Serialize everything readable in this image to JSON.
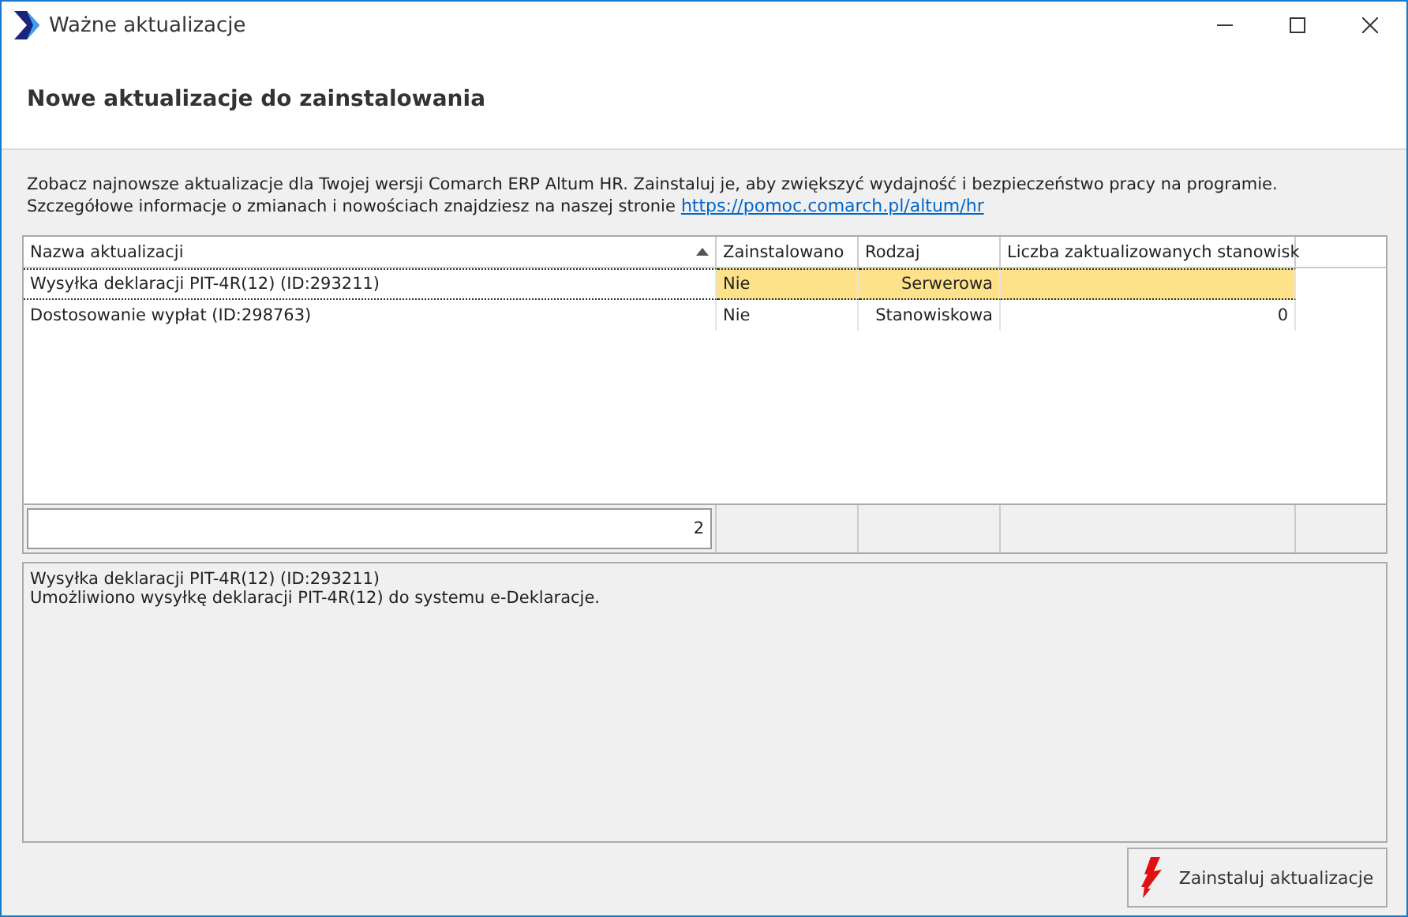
{
  "window": {
    "title": "Ważne aktualizacje"
  },
  "header": {
    "title": "Nowe aktualizacje do zainstalowania"
  },
  "intro": {
    "line_1": "Zobacz najnowsze aktualizacje dla Twojej wersji Comarch ERP Altum HR. Zainstaluj je, aby zwiększyć wydajność i bezpieczeństwo pracy na programie.",
    "line_2": "Szczegółowe informacje o zmianach i nowościach znajdziesz na naszej stronie",
    "link": "https://pomoc.comarch.pl/altum/hr"
  },
  "table": {
    "columns": [
      {
        "label": "Nazwa aktualizacji",
        "sorted": true
      },
      {
        "label": "Zainstalowano",
        "sorted": false
      },
      {
        "label": "Rodzaj",
        "sorted": false
      },
      {
        "label": "Liczba zaktualizowanych stanowisk",
        "sorted": false
      }
    ],
    "rows": [
      {
        "name": "Wysyłka deklaracji PIT-4R(12) (ID:293211)",
        "installed": "Nie",
        "type": "Serwerowa",
        "count": "",
        "selected": true
      },
      {
        "name": "Dostosowanie wypłat  (ID:298763)",
        "installed": "Nie",
        "type": "Stanowiskowa",
        "count": "0",
        "selected": false
      }
    ],
    "footer_count": "2"
  },
  "details": {
    "title": "Wysyłka deklaracji PIT-4R(12) (ID:293211)",
    "description": "Umożliwiono wysyłkę deklaracji PIT-4R(12) do systemu e-Deklaracje."
  },
  "install_button": "Zainstaluj aktualizacje"
}
